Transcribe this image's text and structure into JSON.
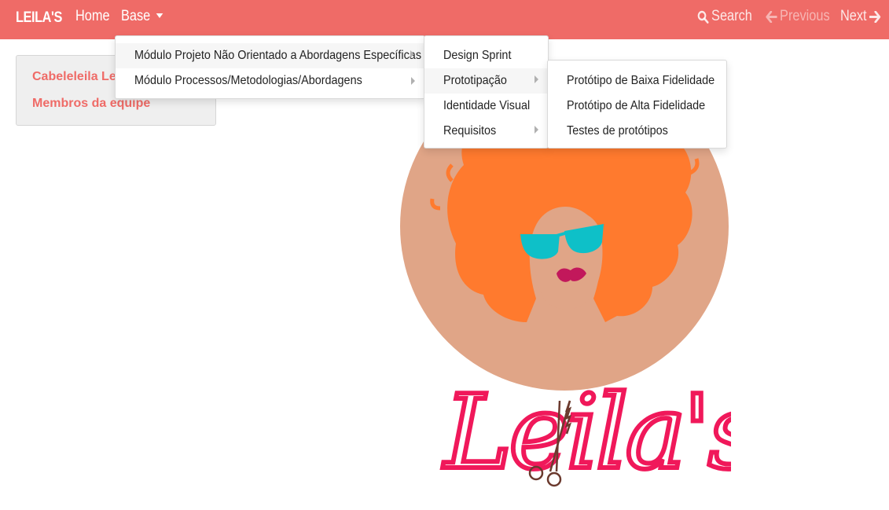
{
  "navbar": {
    "brand": "LEILA'S",
    "home": "Home",
    "base": "Base",
    "search": "Search",
    "previous": "Previous",
    "next": "Next"
  },
  "sidebar": {
    "items": [
      "Cabeleleila Leila",
      "Membros da equipe"
    ]
  },
  "menus": {
    "level1": [
      "Módulo Projeto Não Orientado a Abordagens Específicas",
      "Módulo Processos/Metodologias/Abordagens"
    ],
    "level2": [
      "Design Sprint",
      "Prototipação",
      "Identidade Visual",
      "Requisitos"
    ],
    "level3": [
      "Protótipo de Baixa Fidelidade",
      "Protótipo de Alta Fidelidade",
      "Testes de protótipos"
    ]
  },
  "colors": {
    "navbar": "#ef6b67",
    "hair": "#ff7a2e",
    "skin": "#e0a587",
    "glasses": "#0ec0c8",
    "lips": "#c2185b",
    "script": "#f0185a"
  },
  "logo": {
    "text": "Leila's",
    "icon": "scissors-icon"
  }
}
